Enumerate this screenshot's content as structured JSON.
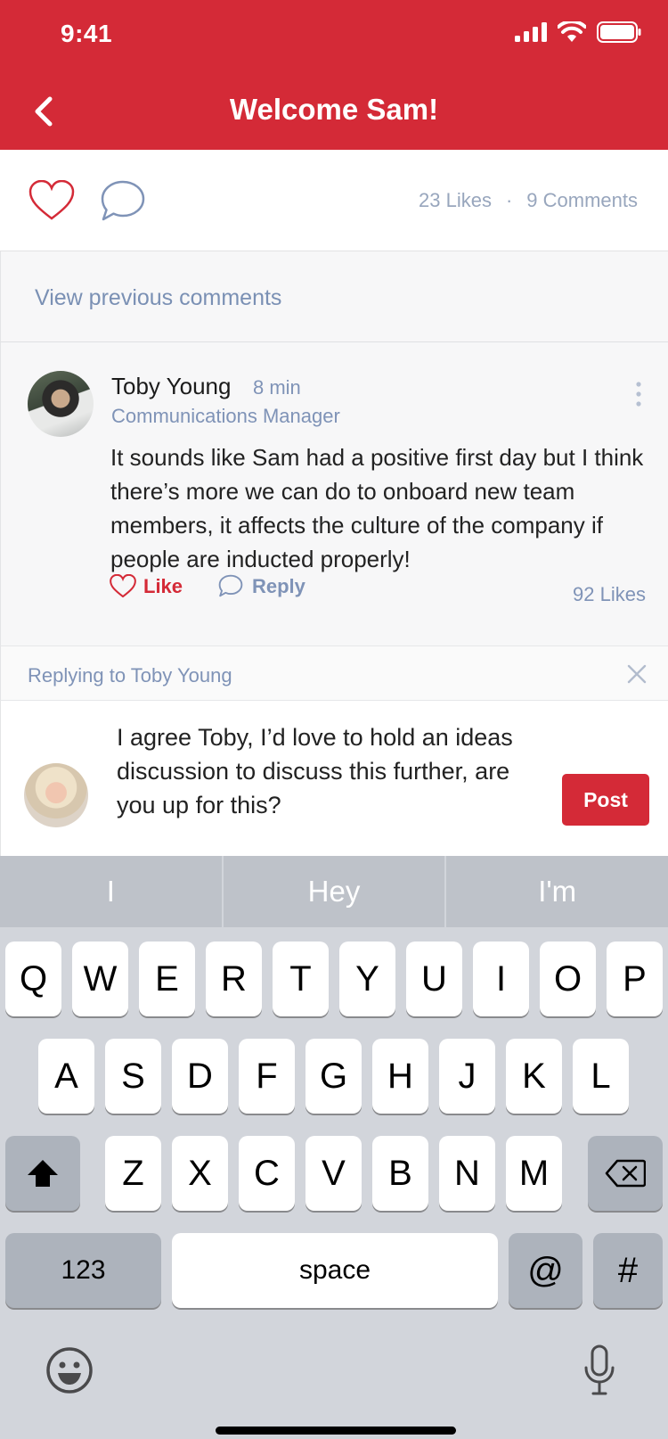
{
  "status_bar": {
    "time": "9:41"
  },
  "header": {
    "title": "Welcome Sam!"
  },
  "post_stats": {
    "likes": "23 Likes",
    "separator": "·",
    "comments": "9 Comments"
  },
  "view_previous": "View previous comments",
  "comment": {
    "author": "Toby Young",
    "time": "8 min",
    "role": "Communications Manager",
    "body": "It sounds like Sam had a positive first day but I think there’s more we can do to onboard new team members, it affects the culture of the company if people are inducted properly!",
    "like_label": "Like",
    "reply_label": "Reply",
    "likes_count": "92 Likes"
  },
  "reply_bar": {
    "label": "Replying to Toby Young"
  },
  "composer": {
    "text": "I agree Toby, I’d love to hold an ideas discussion to discuss this further, are you up for this?",
    "post_label": "Post"
  },
  "keyboard": {
    "suggestions": [
      "I",
      "Hey",
      "I'm"
    ],
    "row1": [
      "Q",
      "W",
      "E",
      "R",
      "T",
      "Y",
      "U",
      "I",
      "O",
      "P"
    ],
    "row2": [
      "A",
      "S",
      "D",
      "F",
      "G",
      "H",
      "J",
      "K",
      "L"
    ],
    "row3": [
      "Z",
      "X",
      "C",
      "V",
      "B",
      "N",
      "M"
    ],
    "numbers_label": "123",
    "space_label": "space",
    "at_label": "@",
    "hash_label": "#"
  },
  "colors": {
    "brand_red": "#d42a37",
    "muted_blue": "#7f93b7"
  }
}
